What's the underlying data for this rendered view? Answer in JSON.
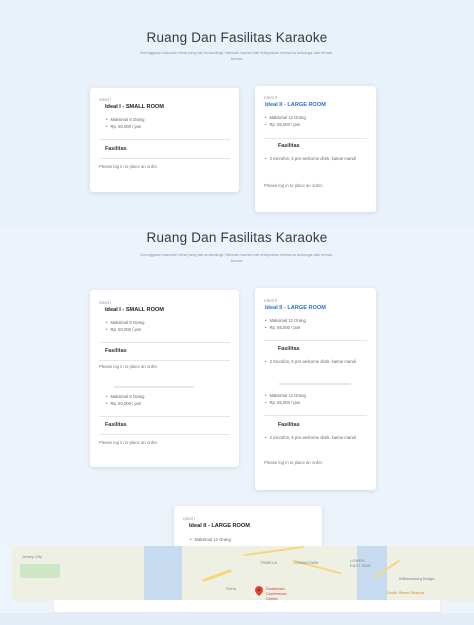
{
  "section1": {
    "title": "Ruang Dan Fasilitas Karaoke",
    "subtitle": "Keunggulan karaoke Ideal yang tak tertandingi. Nikmati momen tak terlupakan bersama keluarga dan teman-teman."
  },
  "section2": {
    "title": "Ruang Dan Fasilitas Karaoke",
    "subtitle": "Keunggulan karaoke Ideal yang tak tertandingi. Nikmati momen tak terlupakan bersama keluarga dan teman-teman."
  },
  "rooms": {
    "small": {
      "img_alt": "Ideal I",
      "name": "Ideal I - SMALL ROOM",
      "capacity": "Maksimal 6 Orang",
      "price": "Rp. 50,000 / jam",
      "facilities_label": "Fasilitas",
      "login_text": "Please log in to place an order."
    },
    "large": {
      "img_alt": "Ideal II",
      "name": "Ideal II - LARGE ROOM",
      "capacity": "Maksimal 12 Orang",
      "price": "Rp. 65,000 / jam",
      "facilities_label": "Fasilitas",
      "facility_item": "4 microfon, 6 pcs welcome drink, kamar mandi",
      "login_text": "Please log in to place an order."
    },
    "large_bottom": {
      "img_alt": "Ideal I",
      "name": "Ideal II - LARGE ROOM",
      "capacity": "Maksimal 12 Orang"
    }
  },
  "map": {
    "labels": {
      "jersey": "Jersey City",
      "tribeca": "TRIBECA",
      "chinatown": "CHINATOWN",
      "lower_east": "LOWER EAST SIDE",
      "williamsburg": "Williamsburg Bridge",
      "soho": "SoHo",
      "seaport": "South Street Seaport",
      "pin": "Downtown Conference Center"
    }
  }
}
